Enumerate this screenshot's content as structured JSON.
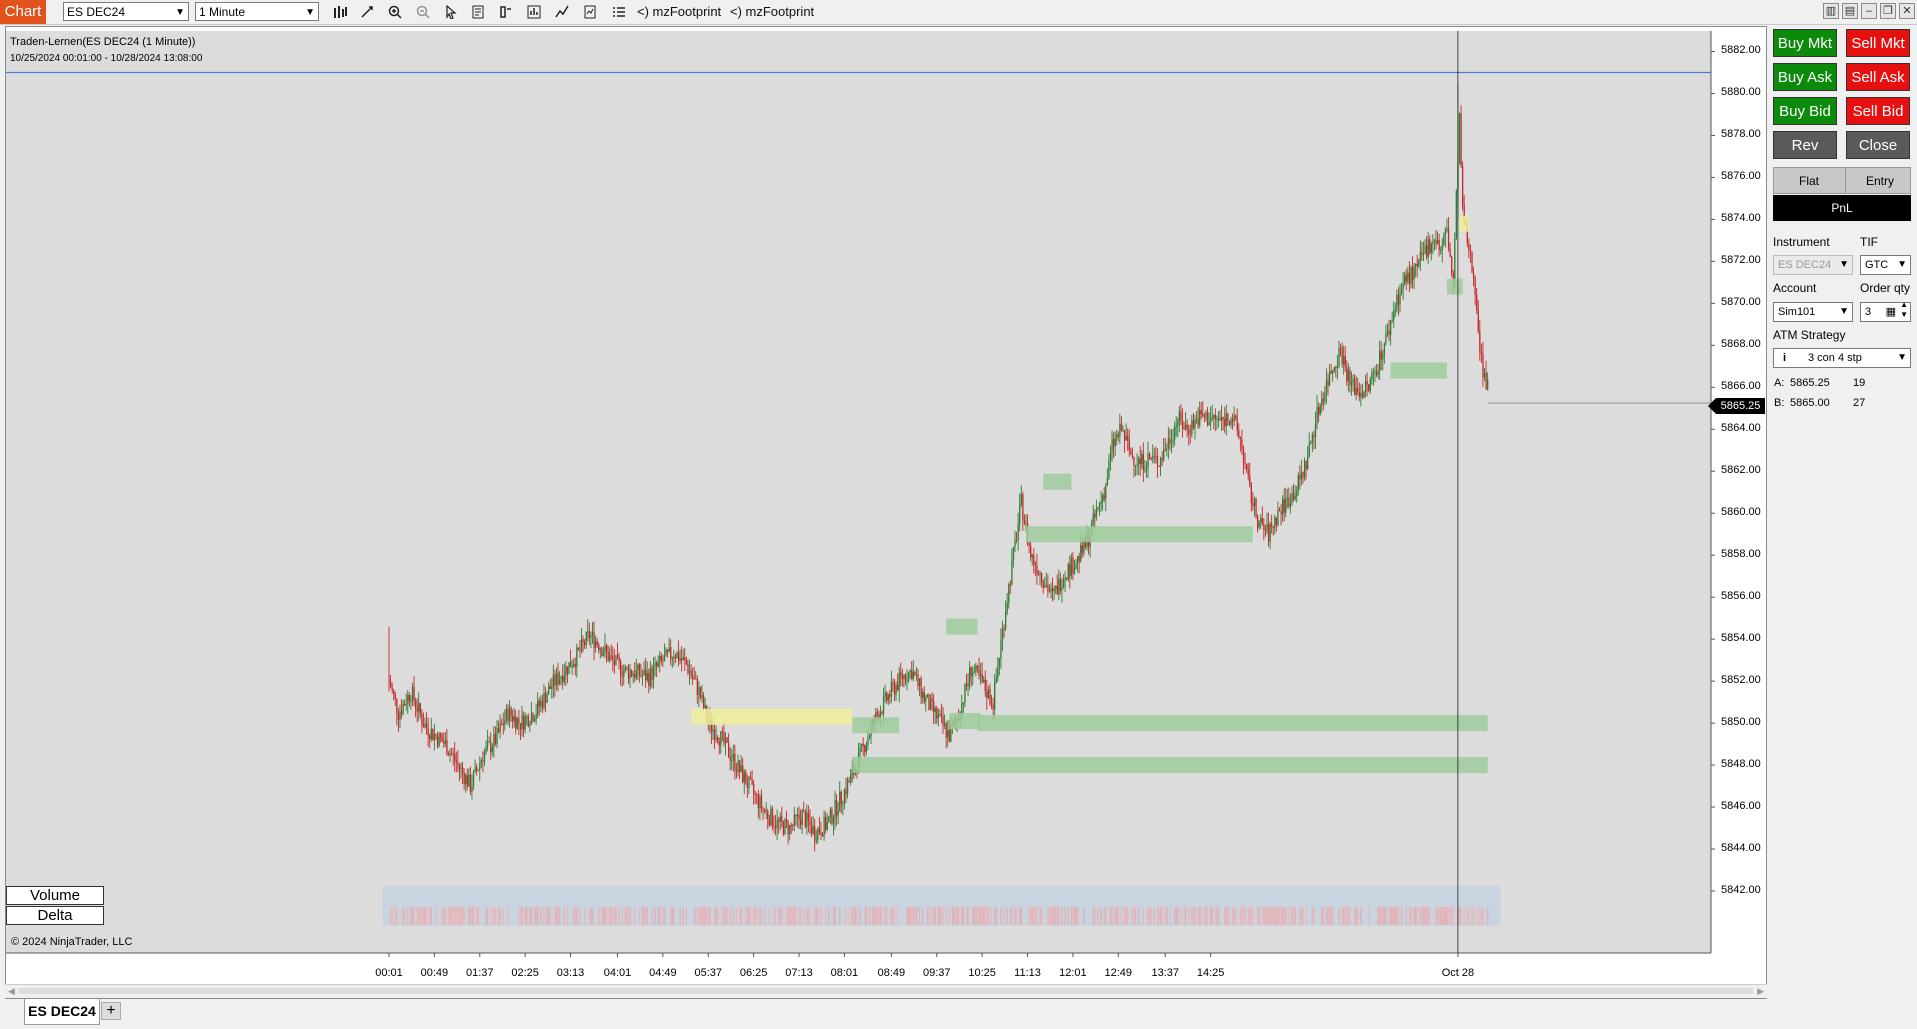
{
  "toolbar": {
    "chart_tab": "Chart",
    "instrument": "ES DEC24",
    "interval": "1 Minute",
    "indicators": [
      "<) mzFootprint",
      "<) mzFootprint"
    ]
  },
  "chart": {
    "title": "Traden-Lernen(ES DEC24 (1 Minute))",
    "range": "10/25/2024 00:01:00 - 10/28/2024 13:08:00",
    "copyright": "© 2024 NinjaTrader, LLC",
    "panel_labels": [
      "Volume",
      "Delta"
    ],
    "current_price": "5865.25"
  },
  "chart_data": {
    "type": "candlestick",
    "y_ticks": [
      "5882.00",
      "5880.00",
      "5878.00",
      "5876.00",
      "5874.00",
      "5872.00",
      "5870.00",
      "5868.00",
      "5866.00",
      "5864.00",
      "5862.00",
      "5860.00",
      "5858.00",
      "5856.00",
      "5854.00",
      "5852.00",
      "5850.00",
      "5848.00",
      "5846.00",
      "5844.00",
      "5842.00"
    ],
    "x_ticks": [
      "00:01",
      "00:49",
      "01:37",
      "02:25",
      "03:13",
      "04:01",
      "04:49",
      "05:37",
      "06:25",
      "07:13",
      "08:01",
      "08:49",
      "09:37",
      "10:25",
      "11:13",
      "12:01",
      "12:49",
      "13:37",
      "14:25",
      "Oct 28"
    ],
    "ylim": [
      5841.0,
      5882.5
    ],
    "horizontal_line_price": 5881.0,
    "price_path": [
      [
        0,
        5852
      ],
      [
        6,
        5850.5
      ],
      [
        14,
        5851.5
      ],
      [
        22,
        5850
      ],
      [
        28,
        5849.5
      ],
      [
        36,
        5849
      ],
      [
        44,
        5848
      ],
      [
        52,
        5847
      ],
      [
        60,
        5848.5
      ],
      [
        68,
        5849.2
      ],
      [
        76,
        5850.5
      ],
      [
        84,
        5850
      ],
      [
        94,
        5850.6
      ],
      [
        104,
        5851.8
      ],
      [
        112,
        5852.5
      ],
      [
        120,
        5853.2
      ],
      [
        128,
        5854.2
      ],
      [
        134,
        5853.8
      ],
      [
        142,
        5853
      ],
      [
        150,
        5852.5
      ],
      [
        158,
        5852.4
      ],
      [
        166,
        5852.2
      ],
      [
        174,
        5852.9
      ],
      [
        182,
        5853.4
      ],
      [
        190,
        5852.8
      ],
      [
        198,
        5851.5
      ],
      [
        204,
        5850
      ],
      [
        210,
        5849.5
      ],
      [
        218,
        5848.5
      ],
      [
        226,
        5847.5
      ],
      [
        234,
        5846.5
      ],
      [
        240,
        5845.8
      ],
      [
        248,
        5845.2
      ],
      [
        256,
        5845
      ],
      [
        264,
        5845.6
      ],
      [
        272,
        5844.8
      ],
      [
        280,
        5845.2
      ],
      [
        288,
        5846.3
      ],
      [
        296,
        5847.5
      ],
      [
        304,
        5849
      ],
      [
        312,
        5850.4
      ],
      [
        320,
        5851.4
      ],
      [
        328,
        5852.2
      ],
      [
        334,
        5852.5
      ],
      [
        342,
        5851.2
      ],
      [
        350,
        5850.3
      ],
      [
        358,
        5849.4
      ],
      [
        364,
        5850.4
      ],
      [
        372,
        5852.6
      ],
      [
        378,
        5852
      ],
      [
        386,
        5851
      ],
      [
        394,
        5855.5
      ],
      [
        400,
        5858.5
      ],
      [
        404,
        5860.5
      ],
      [
        410,
        5858
      ],
      [
        416,
        5857.2
      ],
      [
        424,
        5856
      ],
      [
        432,
        5857.2
      ],
      [
        440,
        5857.8
      ],
      [
        446,
        5858.6
      ],
      [
        452,
        5860
      ],
      [
        458,
        5861.3
      ],
      [
        462,
        5863.2
      ],
      [
        468,
        5864
      ],
      [
        474,
        5862.8
      ],
      [
        480,
        5862.4
      ],
      [
        486,
        5862.6
      ],
      [
        492,
        5862.5
      ],
      [
        498,
        5863.4
      ],
      [
        504,
        5864.5
      ],
      [
        510,
        5864
      ],
      [
        518,
        5864.6
      ],
      [
        526,
        5864.5
      ],
      [
        532,
        5864.4
      ],
      [
        538,
        5864.7
      ],
      [
        544,
        5863.5
      ],
      [
        550,
        5861
      ],
      [
        556,
        5859.5
      ],
      [
        562,
        5859
      ],
      [
        568,
        5860
      ],
      [
        574,
        5860.6
      ],
      [
        580,
        5861.2
      ],
      [
        586,
        5862.4
      ],
      [
        592,
        5864.4
      ],
      [
        596,
        5865.5
      ],
      [
        602,
        5866.8
      ],
      [
        608,
        5867.8
      ],
      [
        614,
        5866.2
      ],
      [
        620,
        5865.8
      ],
      [
        626,
        5866
      ],
      [
        632,
        5867.2
      ],
      [
        638,
        5868.5
      ],
      [
        644,
        5870.2
      ],
      [
        650,
        5871.2
      ],
      [
        656,
        5871.5
      ],
      [
        662,
        5872.5
      ],
      [
        668,
        5873.2
      ],
      [
        672,
        5872.5
      ],
      [
        676,
        5873.5
      ],
      [
        680,
        5870.8
      ],
      [
        682,
        5875
      ],
      [
        684,
        5878.8
      ],
      [
        686,
        5874.3
      ],
      [
        690,
        5872.5
      ],
      [
        694,
        5870.8
      ],
      [
        698,
        5867.2
      ],
      [
        702,
        5866
      ]
    ]
  },
  "panel": {
    "buy_mk": "Buy Mkt",
    "sell_mk": "Sell Mkt",
    "buy_ask": "Buy Ask",
    "sell_ask": "Sell Ask",
    "buy_bid": "Buy Bid",
    "sell_bid": "Sell Bid",
    "rev": "Rev",
    "close": "Close",
    "flat": "Flat",
    "entry": "Entry",
    "pnl": "PnL",
    "instrument_label": "Instrument",
    "instrument_value": "ES DEC24",
    "tif_label": "TIF",
    "tif_value": "GTC",
    "account_label": "Account",
    "account_value": "Sim101",
    "order_qty_label": "Order qty",
    "order_qty_value": "3",
    "atm_label": "ATM Strategy",
    "atm_value": "3 con 4 stp",
    "ask_label": "A:",
    "ask_price": "5865.25",
    "ask_size": "19",
    "bid_label": "B:",
    "bid_price": "5865.00",
    "bid_size": "27"
  },
  "tabs": {
    "active": "ES DEC24"
  },
  "colors": {
    "plot_bg": "#dcdcdc",
    "up_candle": "#2e7d32",
    "down_candle": "#c62828",
    "buy_button": "#0c8a0c",
    "sell_button": "#e61010",
    "chart_tab": "#e2521d",
    "zone_green": "#9ecb9a",
    "zone_yellow": "#eeee9a",
    "price_line": "#4a7fd4"
  }
}
